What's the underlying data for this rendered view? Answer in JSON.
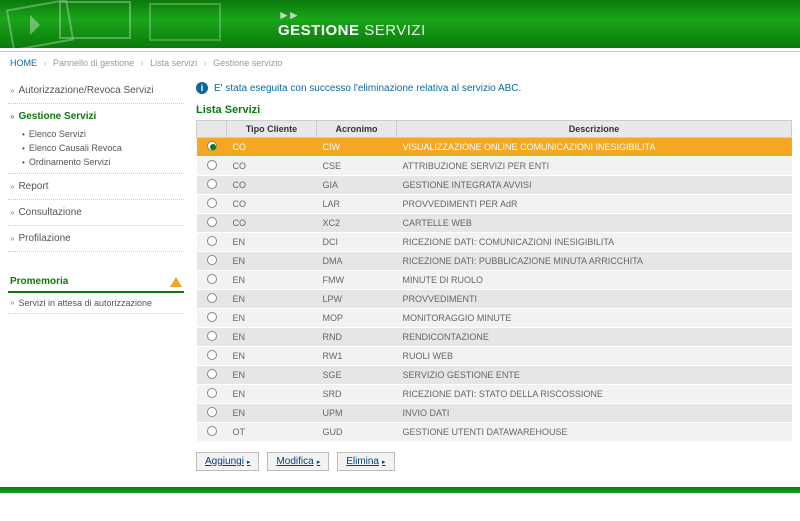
{
  "header": {
    "title_bold": "GESTIONE",
    "title_light": "SERVIZI"
  },
  "breadcrumb": {
    "home": "HOME",
    "items": [
      "Pannello di gestione",
      "Lista servizi",
      "Gestione servizio"
    ]
  },
  "sidebar": {
    "items": [
      {
        "label": "Autorizzazione/Revoca Servizi",
        "active": false
      },
      {
        "label": "Gestione Servizi",
        "active": true,
        "sub": [
          "Elenco Servizi",
          "Elenco Causali Revoca",
          "Ordinamento Servizi"
        ]
      },
      {
        "label": "Report",
        "active": false
      },
      {
        "label": "Consultazione",
        "active": false
      },
      {
        "label": "Profilazione",
        "active": false
      }
    ],
    "promem_title": "Promemoria",
    "promem_items": [
      "Servizi in attesa di autorizzazione"
    ]
  },
  "alert": {
    "text": "E' stata eseguita con successo l'eliminazione relativa al servizio ABC."
  },
  "section_title": "Lista Servizi",
  "table": {
    "headers": {
      "radio": "",
      "tipo": "Tipo Cliente",
      "acronimo": "Acronimo",
      "descrizione": "Descrizione"
    },
    "rows": [
      {
        "selected": true,
        "tipo": "CO",
        "acro": "CIW",
        "desc": "VISUALIZZAZIONE ONLINE COMUNICAZIONI INESIGIBILITA"
      },
      {
        "selected": false,
        "tipo": "CO",
        "acro": "CSE",
        "desc": "ATTRIBUZIONE SERVIZI PER ENTI"
      },
      {
        "selected": false,
        "tipo": "CO",
        "acro": "GIA",
        "desc": "GESTIONE INTEGRATA AVVISI"
      },
      {
        "selected": false,
        "tipo": "CO",
        "acro": "LAR",
        "desc": "PROVVEDIMENTI PER AdR"
      },
      {
        "selected": false,
        "tipo": "CO",
        "acro": "XC2",
        "desc": "CARTELLE WEB"
      },
      {
        "selected": false,
        "tipo": "EN",
        "acro": "DCI",
        "desc": "RICEZIONE DATI: COMUNICAZIONI INESIGIBILITA"
      },
      {
        "selected": false,
        "tipo": "EN",
        "acro": "DMA",
        "desc": "RICEZIONE DATI: PUBBLICAZIONE MINUTA ARRICCHITA"
      },
      {
        "selected": false,
        "tipo": "EN",
        "acro": "FMW",
        "desc": "MINUTE DI RUOLO"
      },
      {
        "selected": false,
        "tipo": "EN",
        "acro": "LPW",
        "desc": "PROVVEDIMENTI"
      },
      {
        "selected": false,
        "tipo": "EN",
        "acro": "MOP",
        "desc": "MONITORAGGIO MINUTE"
      },
      {
        "selected": false,
        "tipo": "EN",
        "acro": "RND",
        "desc": "RENDICONTAZIONE"
      },
      {
        "selected": false,
        "tipo": "EN",
        "acro": "RW1",
        "desc": "RUOLI WEB"
      },
      {
        "selected": false,
        "tipo": "EN",
        "acro": "SGE",
        "desc": "SERVIZIO GESTIONE ENTE"
      },
      {
        "selected": false,
        "tipo": "EN",
        "acro": "SRD",
        "desc": "RICEZIONE DATI: STATO DELLA RISCOSSIONE"
      },
      {
        "selected": false,
        "tipo": "EN",
        "acro": "UPM",
        "desc": "INVIO DATI"
      },
      {
        "selected": false,
        "tipo": "OT",
        "acro": "GUD",
        "desc": "GESTIONE UTENTI DATAWAREHOUSE"
      }
    ]
  },
  "actions": {
    "add": "Aggiungi",
    "edit": "Modifica",
    "delete": "Elimina"
  }
}
